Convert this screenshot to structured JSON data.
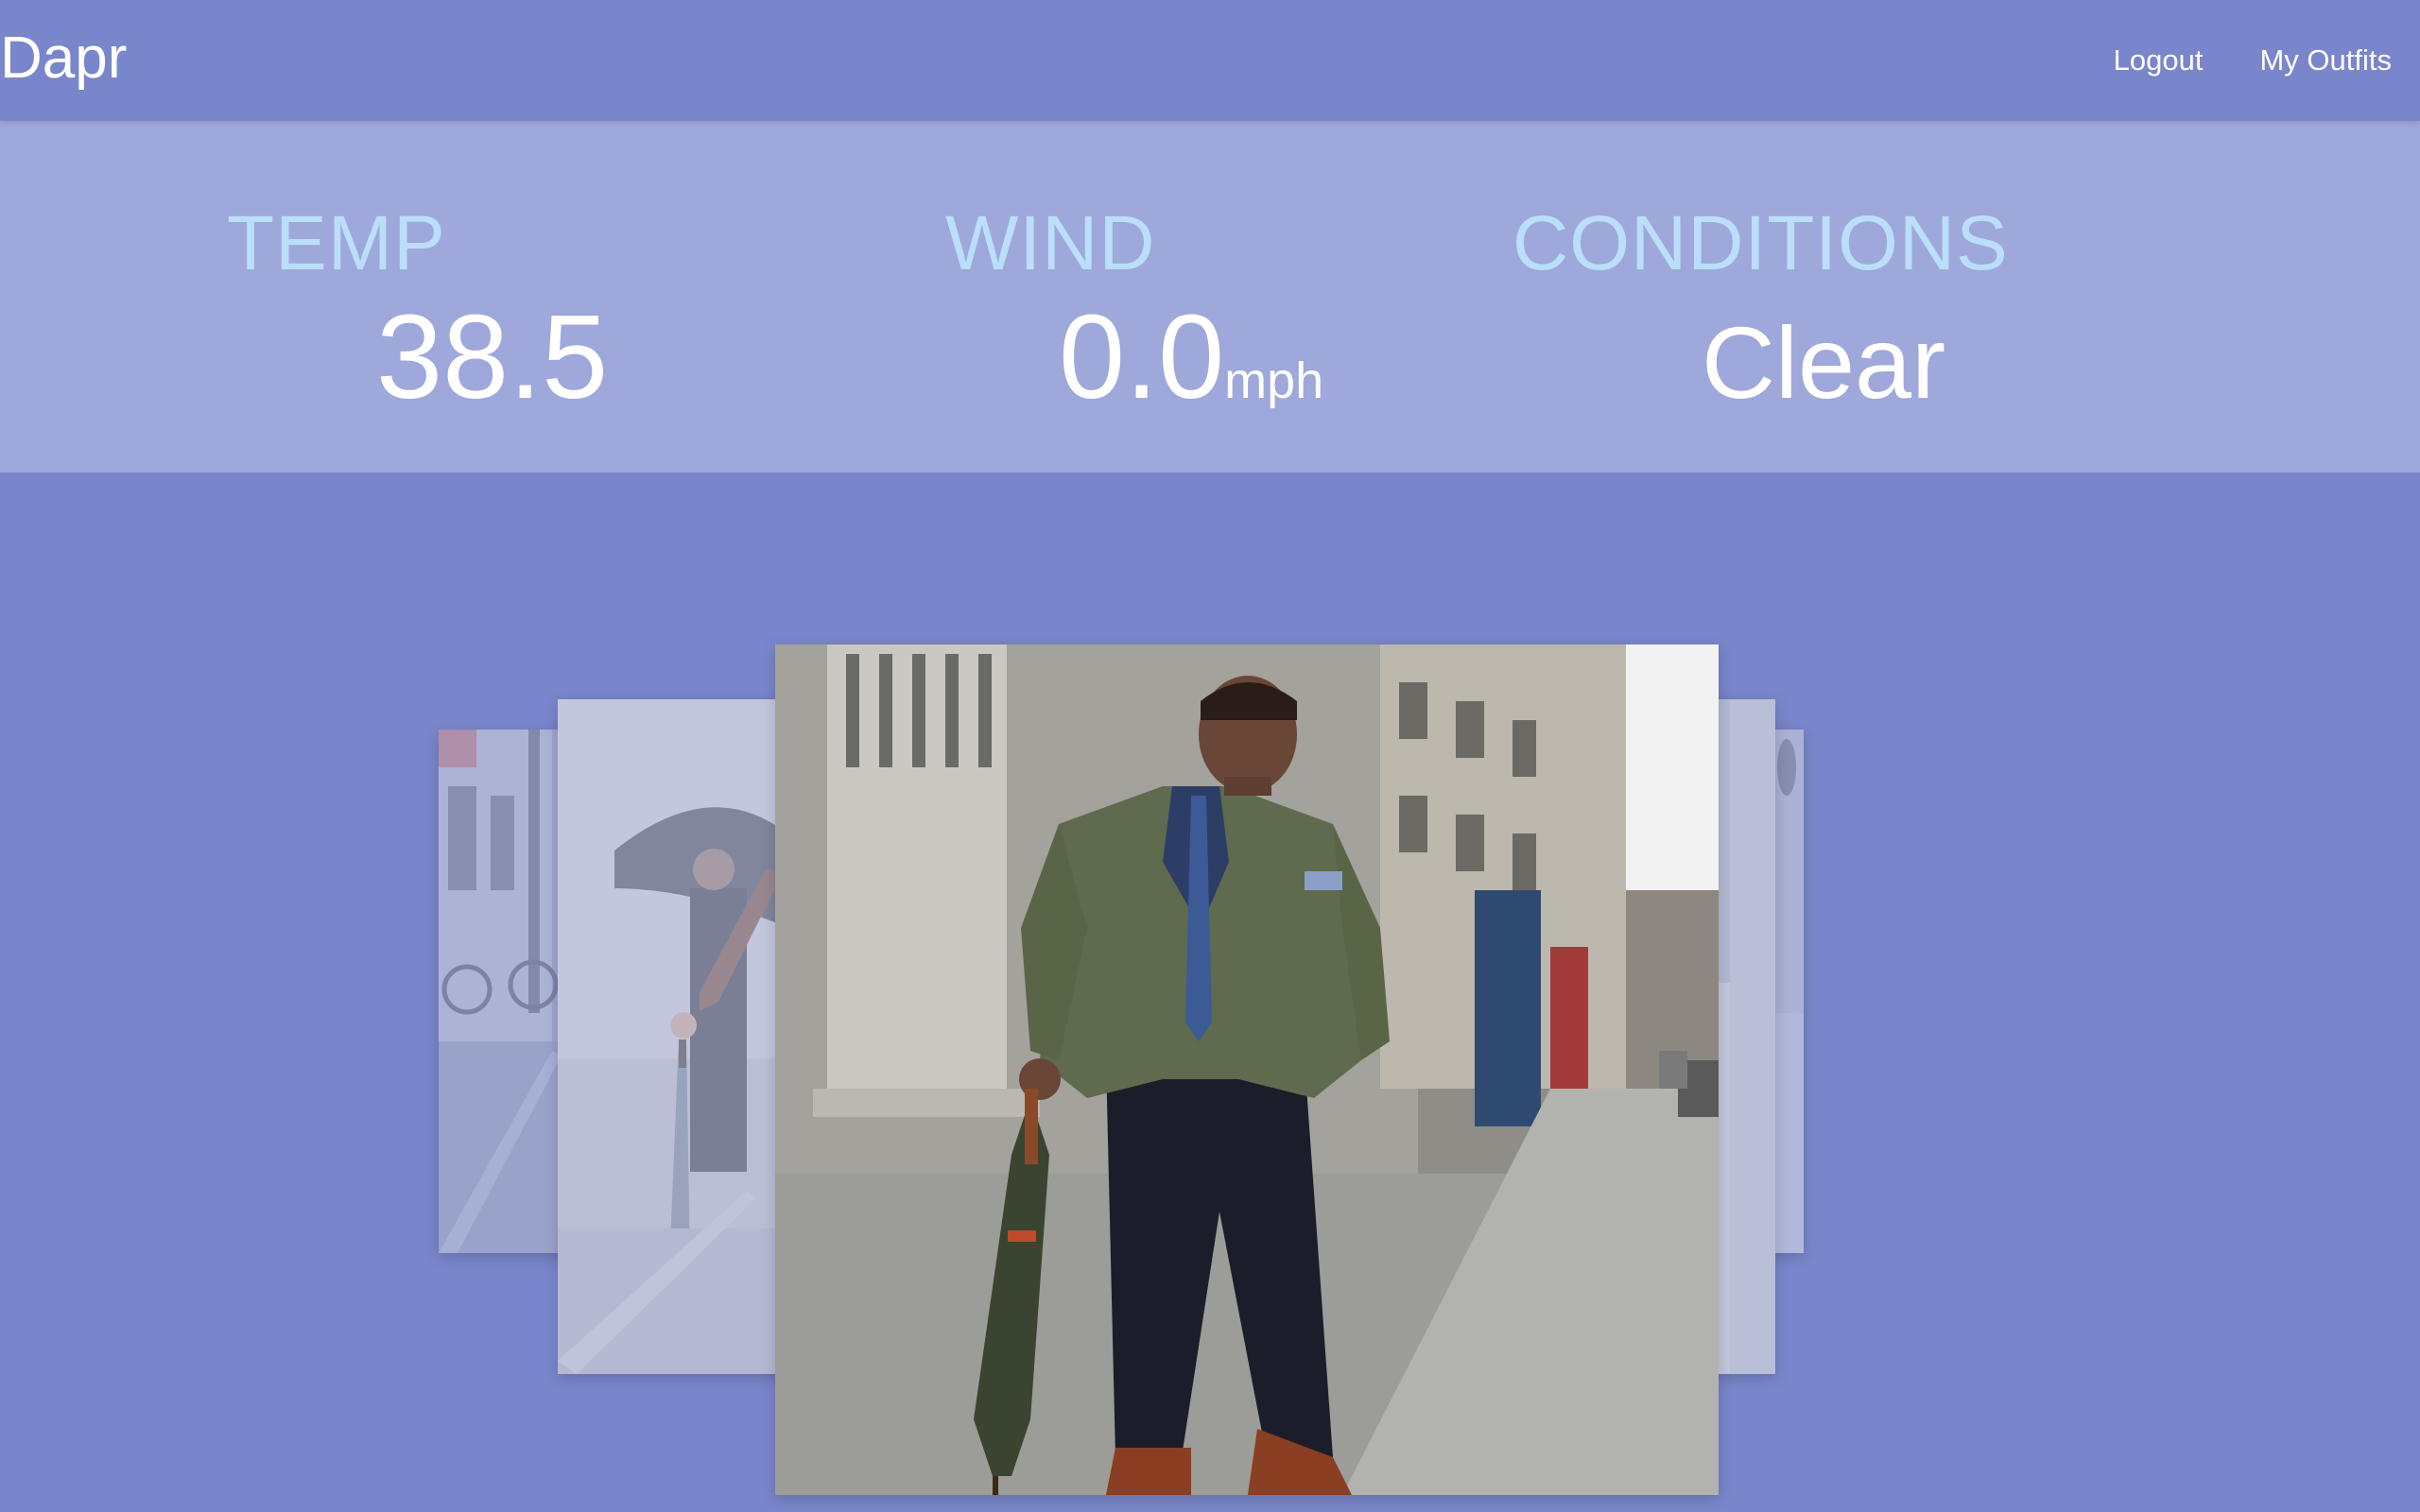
{
  "app": {
    "brand": "Dapr"
  },
  "nav": {
    "links": [
      {
        "label": "Logout"
      },
      {
        "label": "My Outfits"
      }
    ]
  },
  "weather": {
    "temp": {
      "label": "TEMP",
      "value": "38.5"
    },
    "wind": {
      "label": "WIND",
      "value": "0.0",
      "unit": "mph"
    },
    "conditions": {
      "label": "CONDITIONS",
      "value": "Clear"
    }
  },
  "carousel": {
    "active_index": 2,
    "images": [
      {
        "name": "outfit-photo-rainy-street"
      },
      {
        "name": "outfit-photo-umbrella-woman"
      },
      {
        "name": "outfit-photo-quilted-jacket-man"
      },
      {
        "name": "outfit-photo-right-1"
      },
      {
        "name": "outfit-photo-right-2"
      }
    ]
  },
  "colors": {
    "background": "#7986cb",
    "weather_panel": "#9fa8da",
    "label": "#bbdefb",
    "text": "#ffffff"
  }
}
